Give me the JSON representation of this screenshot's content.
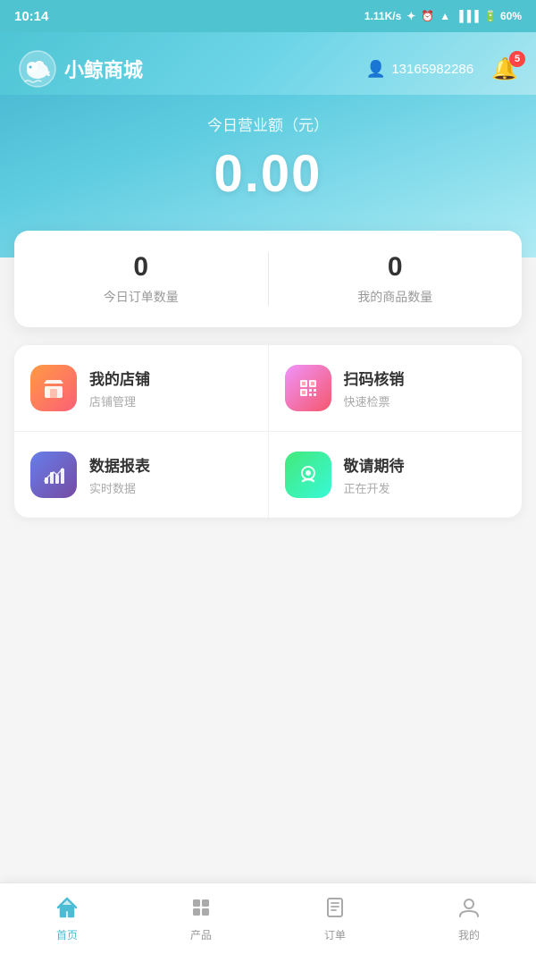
{
  "statusBar": {
    "time": "10:14",
    "signal": "1.11K/s",
    "battery": "60%"
  },
  "header": {
    "appName": "小鲸商城",
    "userId": "13165982286",
    "notificationCount": "5"
  },
  "hero": {
    "revenueLabel": "今日营业额（元）",
    "revenueAmount": "0.00"
  },
  "stats": {
    "todayOrders": {
      "value": "0",
      "label": "今日订单数量"
    },
    "myProducts": {
      "value": "0",
      "label": "我的商品数量"
    }
  },
  "menu": {
    "items": [
      {
        "title": "我的店铺",
        "subtitle": "店铺管理",
        "iconColor": "orange"
      },
      {
        "title": "扫码核销",
        "subtitle": "快速检票",
        "iconColor": "pink"
      },
      {
        "title": "数据报表",
        "subtitle": "实时数据",
        "iconColor": "purple"
      },
      {
        "title": "敬请期待",
        "subtitle": "正在开发",
        "iconColor": "green"
      }
    ]
  },
  "bottomNav": {
    "items": [
      {
        "label": "首页",
        "active": true
      },
      {
        "label": "产品",
        "active": false
      },
      {
        "label": "订单",
        "active": false
      },
      {
        "label": "我的",
        "active": false
      }
    ]
  }
}
